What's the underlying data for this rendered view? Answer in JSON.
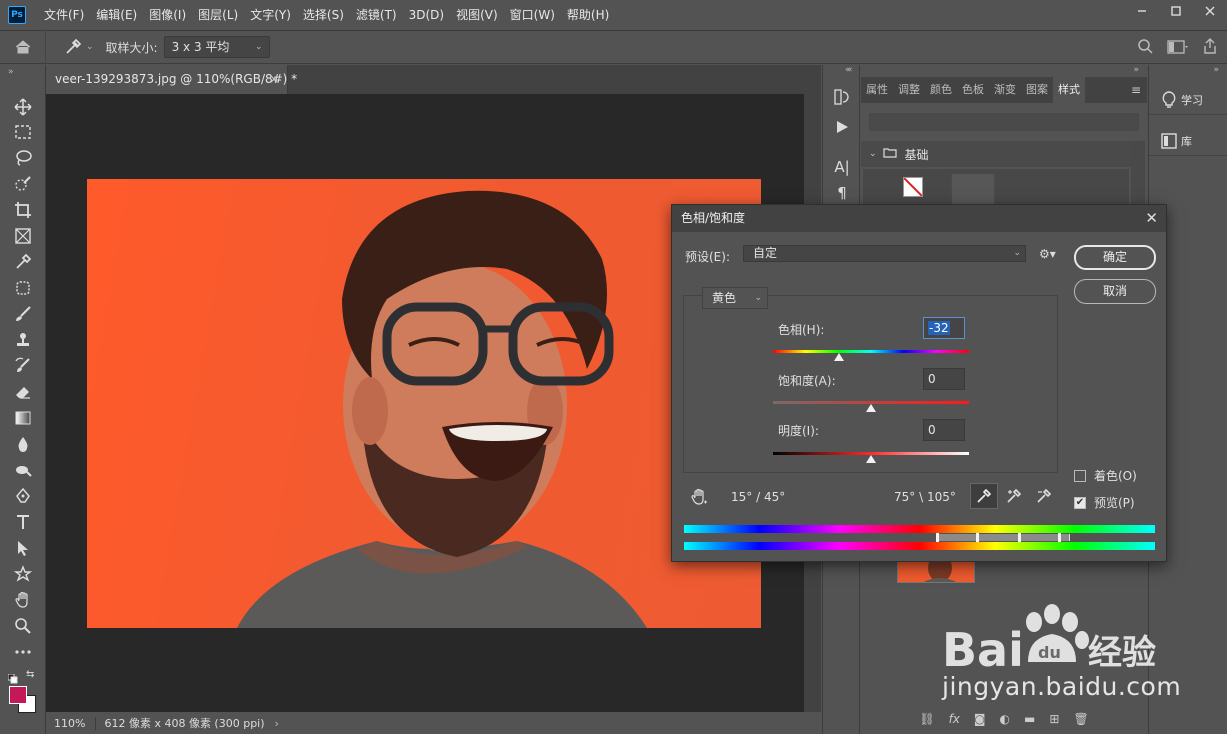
{
  "app": {
    "logo": "Ps"
  },
  "menu": [
    "文件(F)",
    "编辑(E)",
    "图像(I)",
    "图层(L)",
    "文字(Y)",
    "选择(S)",
    "滤镜(T)",
    "3D(D)",
    "视图(V)",
    "窗口(W)",
    "帮助(H)"
  ],
  "options": {
    "sample_label": "取样大小:",
    "sample_value": "3 x 3 平均"
  },
  "document": {
    "tab_title": "veer-139293873.jpg @ 110%(RGB/8#) *",
    "zoom": "110%",
    "info": "612 像素 x 408 像素 (300 ppi)"
  },
  "colors": {
    "foreground": "#c4185a",
    "background": "#ffffff",
    "backdrop": "#ee5b32"
  },
  "panel": {
    "tabs": [
      "属性",
      "调整",
      "颜色",
      "色板",
      "渐变",
      "图案",
      "样式"
    ],
    "active_tab": "样式",
    "group_name": "基础"
  },
  "learn": {
    "learn_label": "学习",
    "library_label": "库"
  },
  "dialog": {
    "title": "色相/饱和度",
    "preset_label": "预设(E):",
    "preset_value": "自定",
    "ok": "确定",
    "cancel": "取消",
    "channel": "黄色",
    "hue_label": "色相(H):",
    "hue_value": "-32",
    "sat_label": "饱和度(A):",
    "sat_value": "0",
    "light_label": "明度(I):",
    "light_value": "0",
    "range_left": "15° / 45°",
    "range_right": "75° \\ 105°",
    "colorize_label": "着色(O)",
    "colorize_checked": false,
    "preview_label": "预览(P)",
    "preview_checked": true
  },
  "watermark": {
    "brand": "Baidu经验",
    "url": "jingyan.baidu.com"
  }
}
